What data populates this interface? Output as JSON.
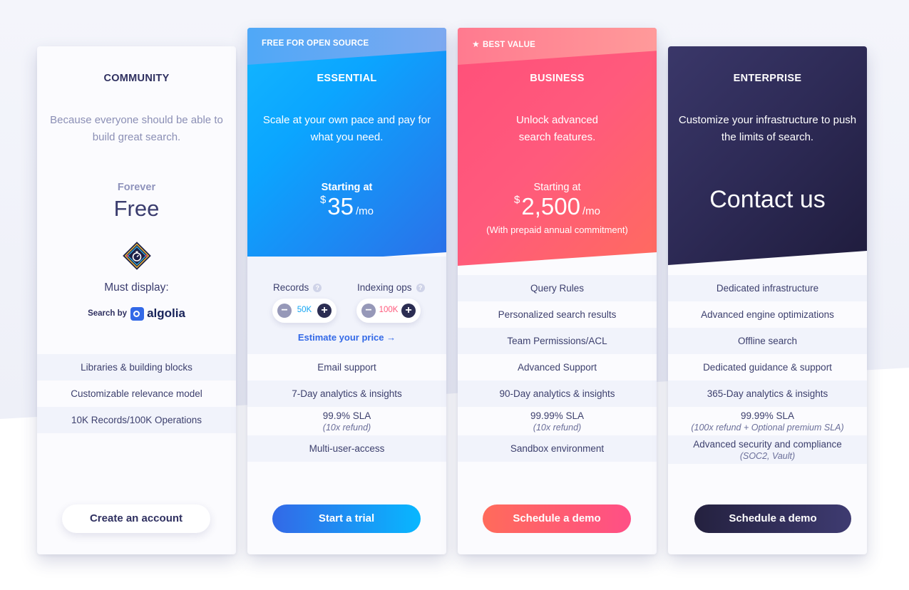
{
  "plans": [
    {
      "name": "COMMUNITY",
      "description": "Because everyone should be able to build great search.",
      "price_label": "Forever",
      "price": "Free",
      "must_display": "Must display:",
      "search_by": "Search by",
      "brand": "algolia",
      "features": [
        {
          "text": "Libraries & building blocks"
        },
        {
          "text": "Customizable relevance model"
        },
        {
          "text": "10K Records/100K Operations"
        }
      ],
      "button": "Create an account"
    },
    {
      "ribbon": "FREE FOR OPEN SOURCE",
      "name": "ESSENTIAL",
      "description": "Scale at your own pace and pay for what you need.",
      "price_label": "Starting at",
      "currency": "$",
      "amount": "35",
      "period": "/mo",
      "records_label": "Records",
      "records_value": "50K",
      "ops_label": "Indexing ops",
      "ops_value": "100K",
      "estimate": "Estimate your price →",
      "features": [
        {
          "text": "Email support"
        },
        {
          "text": "7-Day analytics & insights"
        },
        {
          "text": "99.9% SLA",
          "sub": "(10x refund)"
        },
        {
          "text": "Multi-user-access"
        }
      ],
      "button": "Start a trial"
    },
    {
      "ribbon": "BEST VALUE",
      "name": "BUSINESS",
      "description": "Unlock advanced search features.",
      "price_label": "Starting at",
      "currency": "$",
      "amount": "2,500",
      "period": "/mo",
      "commitment": "(With prepaid annual commitment)",
      "features": [
        {
          "text": "Query Rules"
        },
        {
          "text": "Personalized search results"
        },
        {
          "text": "Team Permissions/ACL"
        },
        {
          "text": "Advanced Support"
        },
        {
          "text": "90-Day analytics & insights"
        },
        {
          "text": "99.99% SLA",
          "sub": "(10x refund)"
        },
        {
          "text": "Sandbox environment"
        }
      ],
      "button": "Schedule a demo"
    },
    {
      "name": "ENTERPRISE",
      "description": "Customize your infrastructure to push the limits of search.",
      "price": "Contact us",
      "features": [
        {
          "text": "Dedicated infrastructure"
        },
        {
          "text": "Advanced engine optimizations"
        },
        {
          "text": "Offline search"
        },
        {
          "text": "Dedicated guidance & support"
        },
        {
          "text": "365-Day analytics & insights"
        },
        {
          "text": "99.99% SLA",
          "sub": "(100x refund + Optional premium SLA)"
        },
        {
          "text": "Advanced security and compliance",
          "sub": "(SOC2, Vault)"
        }
      ],
      "button": "Schedule a demo"
    }
  ],
  "icons": {
    "star": "star-icon",
    "help": "question-icon",
    "minus": "minus-icon",
    "plus": "plus-icon",
    "badge": "stopwatch-badge-icon",
    "algolia": "algolia-logo-icon"
  },
  "colors": {
    "essential_accent": "#0ba5ff",
    "business_accent": "#ff5a7c",
    "enterprise_accent": "#2d2a55",
    "link": "#3369e7"
  }
}
